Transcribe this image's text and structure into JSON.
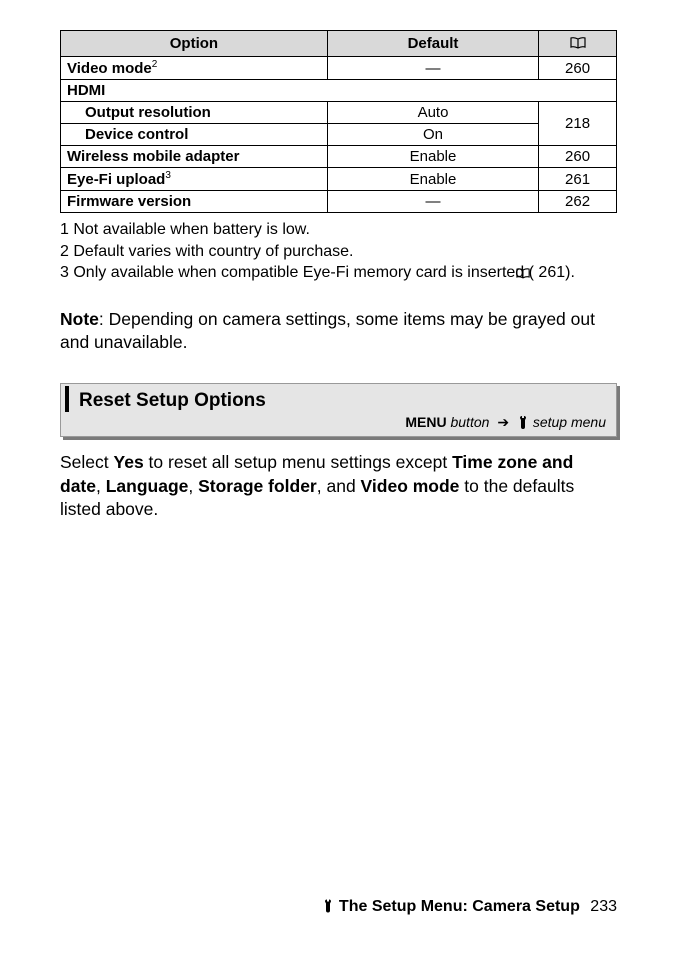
{
  "table": {
    "headers": {
      "option": "Option",
      "default": "Default",
      "pageIconName": "book-icon"
    },
    "rows": {
      "video_mode": {
        "label": "Video mode",
        "sup": "2",
        "default": "—",
        "page": "260"
      },
      "hdmi": {
        "label": "HDMI"
      },
      "output_resolution": {
        "label": "Output resolution",
        "default": "Auto"
      },
      "device_control": {
        "label": "Device control",
        "default": "On"
      },
      "hdmi_page": "218",
      "wireless": {
        "label": "Wireless mobile adapter",
        "default": "Enable",
        "page": "260"
      },
      "eyefi": {
        "label": "Eye-Fi upload",
        "sup": "3",
        "default": "Enable",
        "page": "261"
      },
      "firmware": {
        "label": "Firmware version",
        "default": "—",
        "page": "262"
      }
    }
  },
  "footnotes": {
    "f1": "1  Not available when battery is low.",
    "f2": "2  Default varies with country of purchase.",
    "f3a": "3  Only available when compatible Eye-Fi memory card is inserted (",
    "f3b": " 261)."
  },
  "note": {
    "label": "Note",
    "text": ": Depending on camera settings, some items may be grayed out and unavailable."
  },
  "section": {
    "title": "Reset Setup Options",
    "breadcrumb": {
      "menu": "MENU",
      "button": " button",
      "arrow": "➔",
      "setup": " setup menu"
    }
  },
  "body": {
    "p1a": "Select ",
    "p1b": "Yes",
    "p1c": " to reset all setup menu settings except ",
    "p1d": "Time zone and date",
    "p1e": ", ",
    "p1f": "Language",
    "p1g": ", ",
    "p1h": "Storage folder",
    "p1i": ", and ",
    "p1j": "Video mode",
    "p1k": " to the defaults listed above."
  },
  "footer": {
    "title": "The Setup Menu: Camera Setup",
    "page": "233"
  }
}
